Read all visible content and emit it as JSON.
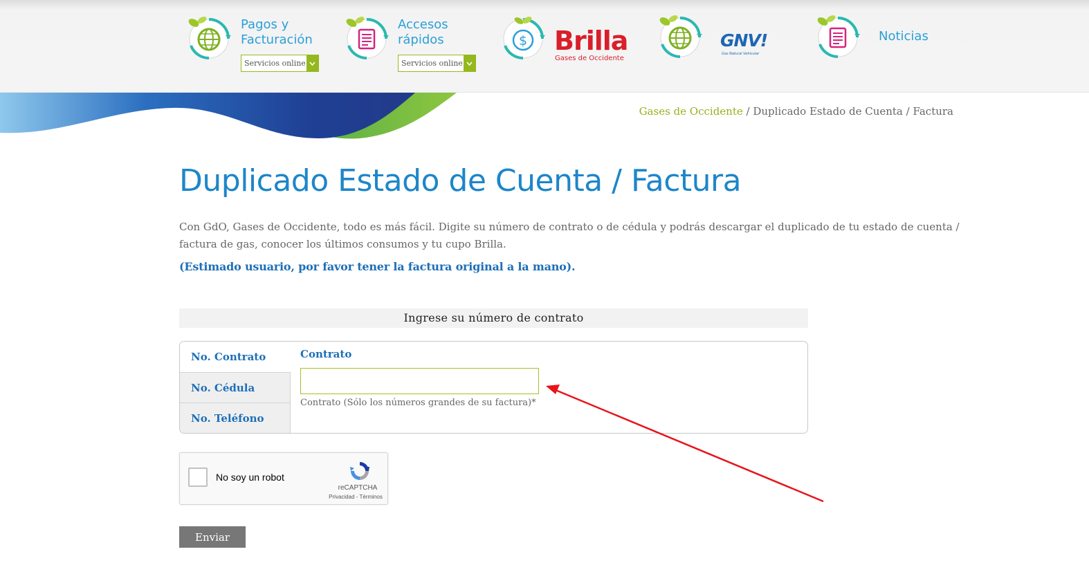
{
  "colors": {
    "brand_blue": "#1d86c9",
    "nav_blue": "#2a9fd8",
    "accent_green": "#95b81f",
    "brilla_red": "#d91f2a",
    "button_gray": "#777777",
    "annotation_red": "#e8141a"
  },
  "nav": {
    "items": [
      {
        "label": "Pagos y\nFacturación",
        "icon": "globe-icon",
        "select_value": "Servicios online"
      },
      {
        "label": "Accesos\nrápidos",
        "icon": "document-icon",
        "select_value": "Servicios online"
      },
      {
        "brand": "Brilla",
        "brand_sub": "Gases de Occidente",
        "icon": "dollar-icon"
      },
      {
        "brand": "GNV!",
        "brand_sub": "Gas Natural Vehicular",
        "icon": "globe-icon"
      },
      {
        "label": "Noticias",
        "icon": "document-icon"
      }
    ]
  },
  "breadcrumb": {
    "home": "Gases de Occidente",
    "rest": " / Duplicado Estado de Cuenta / Factura"
  },
  "main": {
    "title": "Duplicado Estado de Cuenta / Factura",
    "intro": "Con GdO, Gases de Occidente,  todo es más fácil.  Digite su número de contrato o de cédula y podrás descargar el duplicado de tu estado de cuenta / factura de gas, conocer los últimos consumos y tu cupo Brilla.",
    "notice": "(Estimado usuario, por favor tener la factura original a la mano)."
  },
  "form": {
    "header": "Ingrese su número de contrato",
    "tabs": [
      {
        "label": "No. Contrato",
        "active": true
      },
      {
        "label": "No. Cédula",
        "active": false
      },
      {
        "label": "No. Teléfono",
        "active": false
      }
    ],
    "field_label": "Contrato",
    "input_value": "",
    "input_placeholder": "",
    "help_text": "Contrato (Sólo los números grandes de su factura)*"
  },
  "captcha": {
    "label": "No soy un robot",
    "brand": "reCAPTCHA",
    "links": "Privacidad - Términos"
  },
  "submit_label": "Enviar"
}
